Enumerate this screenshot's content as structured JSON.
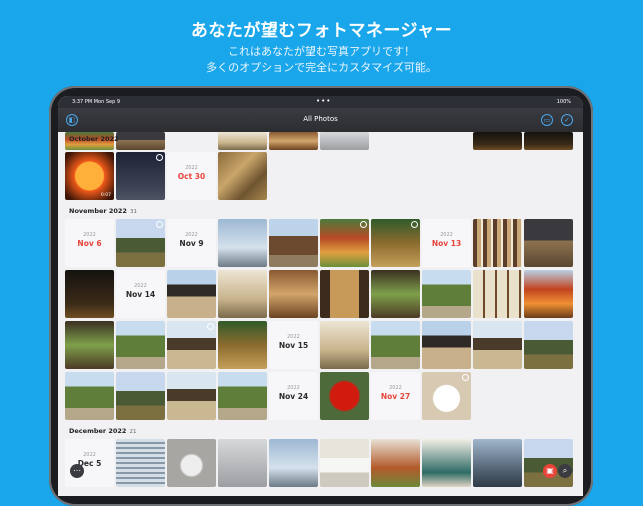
{
  "promo": {
    "headline": "あなたが望むフォトマネージャー",
    "subline1": "これはあなたが望む写真アプリです！",
    "subline2": "多くのオプションで完全にカスタマイズ可能。"
  },
  "status_bar": {
    "time": "3:37 PM  Mon Sep 9",
    "battery": "100%"
  },
  "nav": {
    "title": "All Photos"
  },
  "sections": [
    {
      "label": "October 2022",
      "count": ""
    },
    {
      "label": "November 2022",
      "count": "31"
    },
    {
      "label": "December 2022",
      "count": "21"
    }
  ],
  "date_cards": [
    {
      "year": "2022",
      "day": "Oct 30"
    },
    {
      "year": "2022",
      "day": "Nov 6"
    },
    {
      "year": "2022",
      "day": "Nov 9"
    },
    {
      "year": "2022",
      "day": "Nov 13"
    },
    {
      "year": "2022",
      "day": "Nov 14"
    },
    {
      "year": "2022",
      "day": "Nov 15"
    },
    {
      "year": "2022",
      "day": "Nov 24"
    },
    {
      "year": "2022",
      "day": "Nov 27"
    },
    {
      "year": "2022",
      "day": "Dec 5"
    }
  ],
  "video_duration": "0:07",
  "colors": {
    "accent": "#1aa6ea",
    "date_red": "#e8443a"
  }
}
